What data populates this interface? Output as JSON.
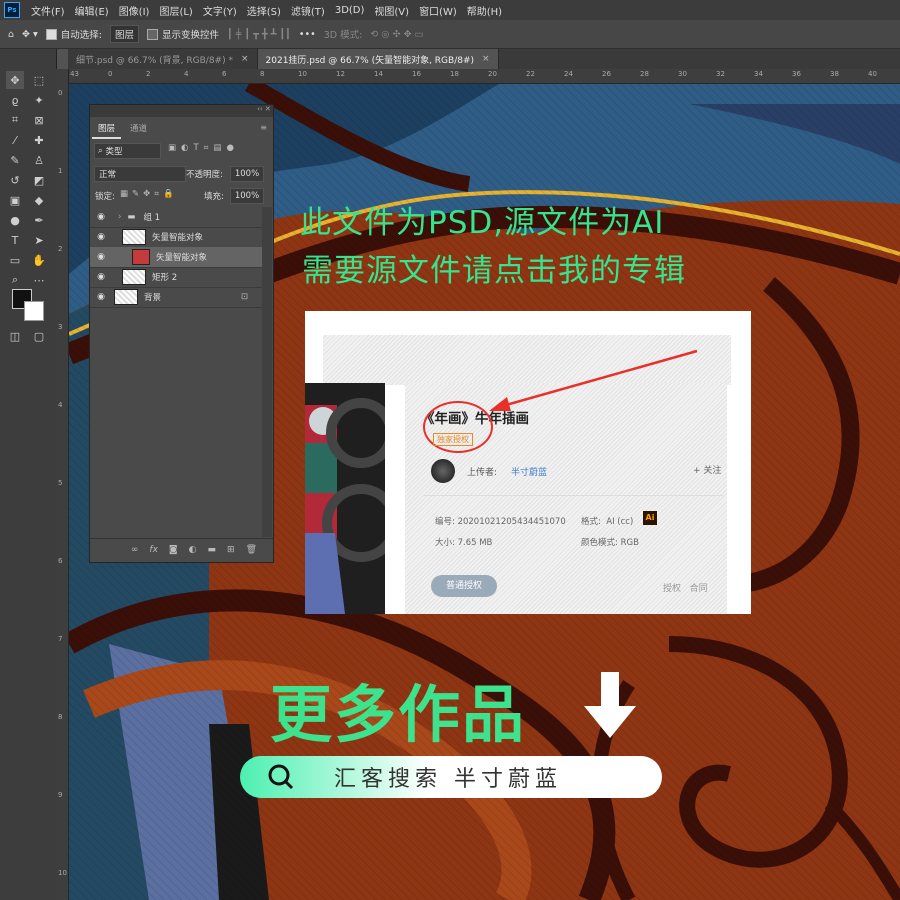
{
  "app": {
    "logo": "Ps"
  },
  "menu": [
    "文件(F)",
    "编辑(E)",
    "图像(I)",
    "图层(L)",
    "文字(Y)",
    "选择(S)",
    "滤镜(T)",
    "3D(D)",
    "视图(V)",
    "窗口(W)",
    "帮助(H)"
  ],
  "options": {
    "auto_select_label": "自动选择:",
    "auto_select_value": "图层",
    "show_transform_label": "显示变换控件",
    "mode_3d_label": "3D 模式:",
    "more": "•••"
  },
  "tabs": [
    {
      "label": "细节.psd @ 66.7% (背景, RGB/8#) *",
      "close": "×"
    },
    {
      "label": "2021挂历.psd @ 66.7% (矢量智能对象, RGB/8#)",
      "close": "×"
    }
  ],
  "ruler": {
    "top": [
      "43",
      "0",
      "2",
      "4",
      "6",
      "8",
      "10",
      "12",
      "14",
      "16",
      "18",
      "20",
      "22",
      "24",
      "26",
      "28",
      "30",
      "32",
      "34",
      "36",
      "38",
      "40"
    ],
    "left": [
      "0",
      "1",
      "2",
      "3",
      "4",
      "5",
      "6",
      "7",
      "8",
      "9",
      "10"
    ]
  },
  "layers_panel": {
    "tabs": [
      "图层",
      "通道"
    ],
    "filter": "类型",
    "blend_mode": "正常",
    "opacity_label": "不透明度:",
    "opacity_value": "100%",
    "lock_label": "锁定:",
    "fill_label": "填充:",
    "fill_value": "100%",
    "layers": [
      {
        "name": "组 1"
      },
      {
        "name": "矢量智能对象"
      },
      {
        "name": "矢量智能对象"
      },
      {
        "name": "矩形 2"
      },
      {
        "name": "背景"
      }
    ],
    "footer_icons": [
      "link-icon",
      "fx-icon",
      "mask-icon",
      "adjustment-icon",
      "folder-icon",
      "new-layer-icon",
      "trash-icon"
    ]
  },
  "overlay": {
    "line1": "此文件为PSD,源文件为AI",
    "line2": "需要源文件请点击我的专辑",
    "more_works": "更多作品",
    "search_text": "汇客搜索  半寸蔚蓝"
  },
  "card": {
    "title_bracket": "《年画》",
    "title_rest": "牛年插画",
    "badge": "独家授权",
    "uploader_label": "上传者:",
    "uploader_name": "半寸蔚蓝",
    "follow": "+ 关注",
    "id_label": "编号:",
    "id_value": "20201021205434451070",
    "format_label": "格式:",
    "format_value": "AI (cc)",
    "ai_badge": "Ai",
    "size_label": "大小:",
    "size_value": "7.65 MB",
    "color_label": "颜色模式:",
    "color_value": "RGB",
    "license_button": "普通授权",
    "link1": "授权",
    "link2": "合同"
  },
  "colors": {
    "accent_green": "#34e58e",
    "annotation_red": "#e8302a",
    "canvas_brown": "#8e3513"
  }
}
